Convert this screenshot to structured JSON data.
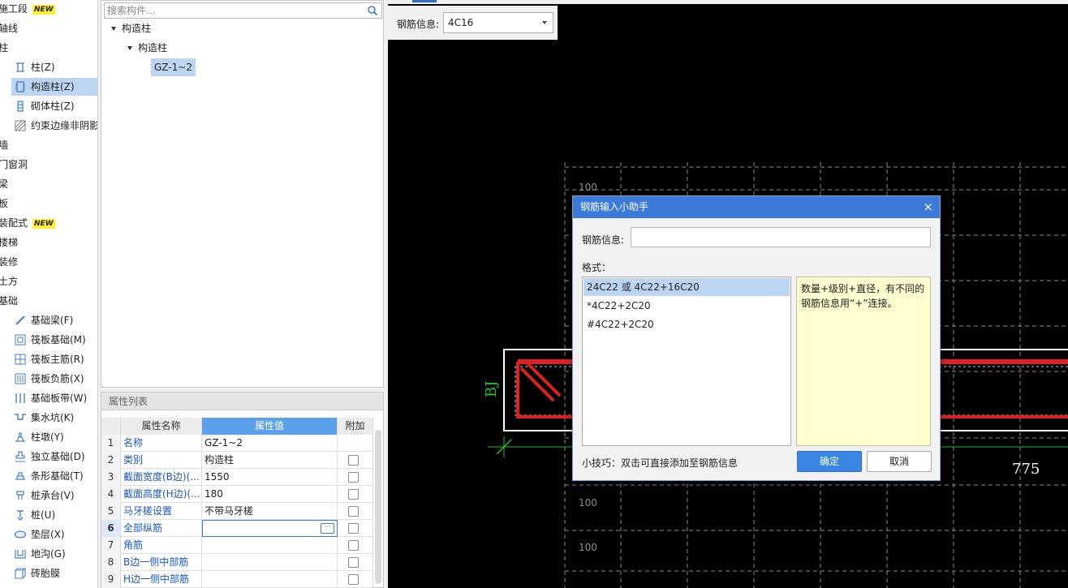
{
  "nav": {
    "items": [
      {
        "label": "施工段",
        "new": true,
        "kind": "cat",
        "icon": "none"
      },
      {
        "label": "轴线",
        "kind": "cat",
        "icon": "none"
      },
      {
        "label": "柱",
        "kind": "cat",
        "icon": "none"
      },
      {
        "label": "柱(Z)",
        "kind": "sub",
        "icon": "column-icon"
      },
      {
        "label": "构造柱(Z)",
        "kind": "sub",
        "icon": "constructional-column-icon",
        "selected": true
      },
      {
        "label": "砌体柱(Z)",
        "kind": "sub",
        "icon": "masonry-column-icon"
      },
      {
        "label": "约束边缘非阴影",
        "kind": "sub",
        "icon": "hatch-icon"
      },
      {
        "label": "墙",
        "kind": "cat",
        "icon": "none"
      },
      {
        "label": "门窗洞",
        "kind": "cat",
        "icon": "none"
      },
      {
        "label": "梁",
        "kind": "cat",
        "icon": "none"
      },
      {
        "label": "板",
        "kind": "cat",
        "icon": "none"
      },
      {
        "label": "装配式",
        "new": true,
        "kind": "cat",
        "icon": "none"
      },
      {
        "label": "楼梯",
        "kind": "cat",
        "icon": "none"
      },
      {
        "label": "装修",
        "kind": "cat",
        "icon": "none"
      },
      {
        "label": "土方",
        "kind": "cat",
        "icon": "none"
      },
      {
        "label": "基础",
        "kind": "cat",
        "icon": "none"
      },
      {
        "label": "基础梁(F)",
        "kind": "sub",
        "icon": "foundation-beam-icon"
      },
      {
        "label": "筏板基础(M)",
        "kind": "sub",
        "icon": "raft-foundation-icon"
      },
      {
        "label": "筏板主筋(R)",
        "kind": "sub",
        "icon": "raft-main-rebar-icon"
      },
      {
        "label": "筏板负筋(X)",
        "kind": "sub",
        "icon": "raft-negative-rebar-icon"
      },
      {
        "label": "基础板带(W)",
        "kind": "sub",
        "icon": "foundation-strip-icon"
      },
      {
        "label": "集水坑(K)",
        "kind": "sub",
        "icon": "sump-icon"
      },
      {
        "label": "柱墩(Y)",
        "kind": "sub",
        "icon": "column-pier-icon"
      },
      {
        "label": "独立基础(D)",
        "kind": "sub",
        "icon": "isolated-foundation-icon"
      },
      {
        "label": "条形基础(T)",
        "kind": "sub",
        "icon": "strip-foundation-icon"
      },
      {
        "label": "桩承台(V)",
        "kind": "sub",
        "icon": "pile-cap-icon"
      },
      {
        "label": "桩(U)",
        "kind": "sub",
        "icon": "pile-icon"
      },
      {
        "label": "垫层(X)",
        "kind": "sub",
        "icon": "cushion-icon"
      },
      {
        "label": "地沟(G)",
        "kind": "sub",
        "icon": "trench-icon"
      },
      {
        "label": "砖胎膜",
        "kind": "sub",
        "icon": "brick-mold-icon"
      }
    ],
    "new_badge": "NEW"
  },
  "tree": {
    "search_placeholder": "搜索构件...",
    "root": "构造柱",
    "child": "构造柱",
    "leaf": "GZ-1~2"
  },
  "props": {
    "title": "属性列表",
    "headers": {
      "name": "属性名称",
      "value": "属性值",
      "extra": "附加"
    },
    "rows": [
      {
        "idx": "1",
        "name": "名称",
        "value": "GZ-1~2",
        "checkbox": false
      },
      {
        "idx": "2",
        "name": "类别",
        "value": "构造柱",
        "checkbox": true
      },
      {
        "idx": "3",
        "name": "截面宽度(B边)(...",
        "value": "1550",
        "checkbox": true
      },
      {
        "idx": "4",
        "name": "截面高度(H边)(...",
        "value": "180",
        "checkbox": true
      },
      {
        "idx": "5",
        "name": "马牙槎设置",
        "value": "不带马牙槎",
        "checkbox": true
      },
      {
        "idx": "6",
        "name": "全部纵筋",
        "value": "",
        "checkbox": true,
        "active": true
      },
      {
        "idx": "7",
        "name": "角筋",
        "value": "",
        "checkbox": true
      },
      {
        "idx": "8",
        "name": "B边一侧中部筋",
        "value": "",
        "checkbox": true
      },
      {
        "idx": "9",
        "name": "H边一侧中部筋",
        "value": "",
        "checkbox": true
      }
    ],
    "more_glyph": "···"
  },
  "canvas": {
    "rebar_label": "钢筋信息:",
    "rebar_value": "4C16",
    "dim_labels": [
      "100",
      "100",
      "100"
    ],
    "side_label": "BJ",
    "dimension_775": "775"
  },
  "dialog": {
    "title": "钢筋输入小助手",
    "close_glyph": "×",
    "info_label": "钢筋信息:",
    "info_value": "",
    "format_label": "格式：",
    "formats": [
      "24C22 或 4C22+16C20",
      "*4C22+2C20",
      "#4C22+2C20"
    ],
    "description": "数量+级别+直径，有不同的钢筋信息用“+”连接。",
    "tip": "小技巧：双击可直接添加至钢筋信息",
    "ok_label": "确定",
    "cancel_label": "取消"
  },
  "colors": {
    "accent": "#3b7ad9",
    "selection": "#bcd5f2",
    "rebar_red": "#e02020",
    "dim_green": "#22c022",
    "grid_gray": "#8a8a8a"
  }
}
